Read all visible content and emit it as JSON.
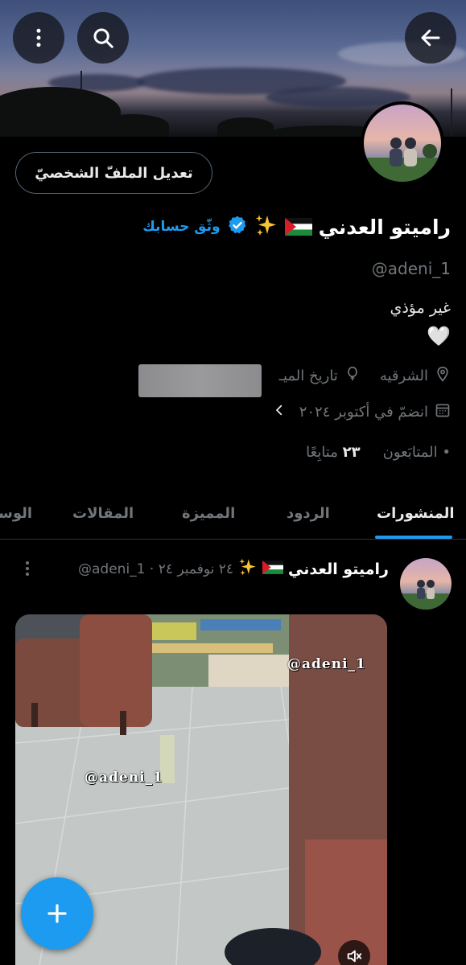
{
  "header": {
    "back_icon": "arrow-left-icon",
    "search_icon": "search-icon",
    "more_icon": "more-vertical-icon"
  },
  "profile": {
    "edit_button": "تعديل الملفّ الشخصيّ",
    "name": "راميتو العدني",
    "verify_link": "وثّق حسابك",
    "handle": "@adeni_1",
    "bio_line1": "غير مؤذي",
    "bio_line2": "🤍",
    "location": "الشرقيه",
    "birthdate_label": "تاريخ الميـ",
    "joined": "انضمّ في أكتوبر ٢٠٢٤",
    "followers_label": "المتابَعون",
    "following_count": "٢٣",
    "following_label": "متابِعًا",
    "dot": "•"
  },
  "tabs": [
    {
      "label": "المنشورات",
      "active": true
    },
    {
      "label": "الردود",
      "active": false
    },
    {
      "label": "المميزة",
      "active": false
    },
    {
      "label": "المقالات",
      "active": false
    },
    {
      "label": "الوسـ",
      "active": false
    }
  ],
  "post": {
    "author": "راميتو العدني",
    "meta": "@adeni_1 · ٢٤ نوفمبر ٢٤",
    "watermark_1": "@adeni_1",
    "watermark_2": "@adeni_1"
  },
  "colors": {
    "accent": "#1d9bf0",
    "muted": "#71767b",
    "background": "#000000"
  }
}
